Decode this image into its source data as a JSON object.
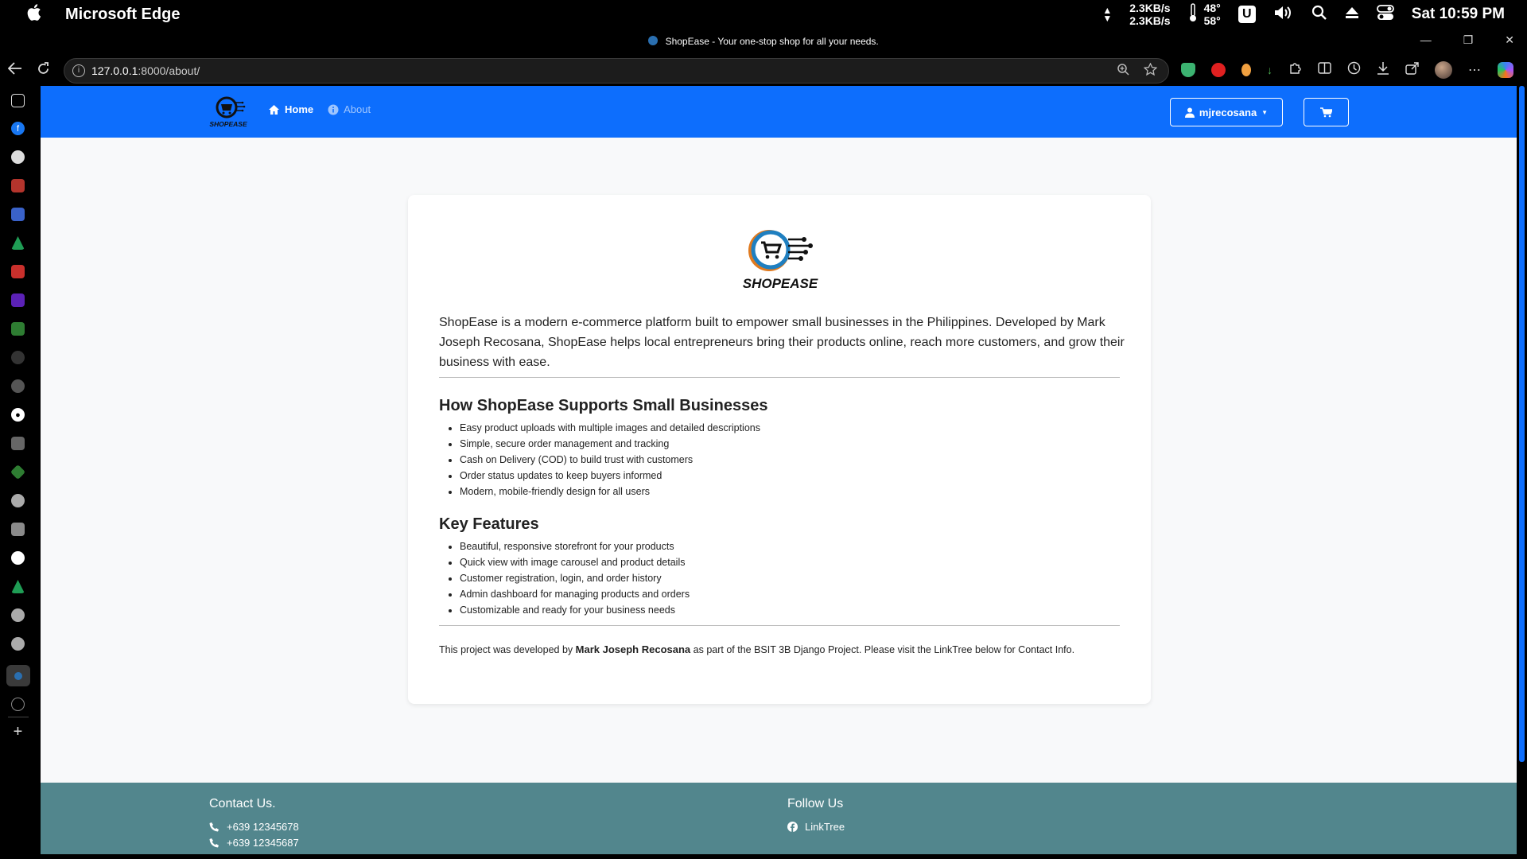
{
  "macbar": {
    "app_name": "Microsoft Edge",
    "net_up": "2.3KB/s",
    "net_down": "2.3KB/s",
    "temp_1": "48°",
    "temp_2": "58°",
    "u_label": "U",
    "clock": "Sat 10:59 PM"
  },
  "browser": {
    "tab_title": "ShopEase - Your one-stop shop for all your needs.",
    "url_host": "127.0.0.1",
    "url_rest": ":8000/about/"
  },
  "navbar": {
    "brand_text": "SHOPEASE",
    "home_label": "Home",
    "about_label": "About",
    "user_label": "mjrecosana"
  },
  "content": {
    "logo_text": "SHOPEASE",
    "intro": "ShopEase is a modern e-commerce platform built to empower small businesses in the Philippines. Developed by Mark Joseph Recosana, ShopEase helps local entrepreneurs bring their products online, reach more customers, and grow their business with ease.",
    "section1_title": "How ShopEase Supports Small Businesses",
    "section1_items": [
      "Easy product uploads with multiple images and detailed descriptions",
      "Simple, secure order management and tracking",
      "Cash on Delivery (COD) to build trust with customers",
      "Order status updates to keep buyers informed",
      "Modern, mobile-friendly design for all users"
    ],
    "section2_title": "Key Features",
    "section2_items": [
      "Beautiful, responsive storefront for your products",
      "Quick view with image carousel and product details",
      "Customer registration, login, and order history",
      "Admin dashboard for managing products and orders",
      "Customizable and ready for your business needs"
    ],
    "credit_pre": "This project was developed by",
    "credit_name": "Mark Joseph Recosana",
    "credit_post": "as part of the BSIT 3B Django Project. Please visit the LinkTree below for Contact Info."
  },
  "footer": {
    "contact_title": "Contact Us.",
    "phone_1": "+639 12345678",
    "phone_2": "+639 12345687",
    "follow_title": "Follow Us",
    "linktree_label": "LinkTree"
  },
  "colors": {
    "primary": "#0d6efd",
    "footer_bg": "#52868d"
  }
}
